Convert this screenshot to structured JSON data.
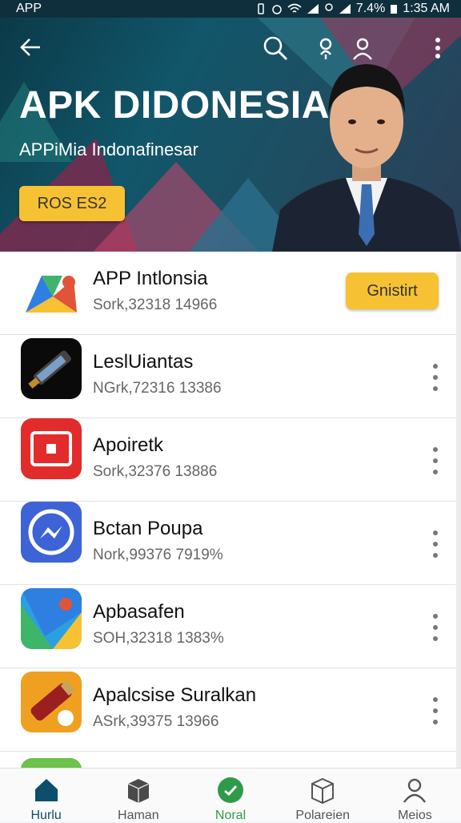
{
  "status_bar": {
    "app_label": "APP",
    "battery": "7.4%",
    "time": "1:35 AM"
  },
  "header": {
    "title": "APK DIDONESIA",
    "subtitle": "APPiMia Indonafinesar",
    "button_label": "ROS ES2"
  },
  "apps": [
    {
      "name": "APP Intlonsia",
      "meta": "Sork,32318 14966",
      "action": "Gnistirt",
      "icon": "maps-pin-icon"
    },
    {
      "name": "LeslUiantas",
      "meta": "NGrk,72316 13386",
      "action": "more",
      "icon": "phone-device-icon"
    },
    {
      "name": "Apoiretk",
      "meta": "Sork,32376 13886",
      "action": "more",
      "icon": "record-icon"
    },
    {
      "name": "Bctan Poupa",
      "meta": "Nork,99376 7919%",
      "action": "more",
      "icon": "messenger-icon"
    },
    {
      "name": "Apbasafen",
      "meta": "SOH,32318 1383%",
      "action": "more",
      "icon": "maps-icon"
    },
    {
      "name": "Apalcsise Suralkan",
      "meta": "ASrk,39375 13966",
      "action": "more",
      "icon": "tool-icon"
    }
  ],
  "bottom_nav": [
    {
      "label": "Hurlu",
      "icon": "home-icon"
    },
    {
      "label": "Haman",
      "icon": "box-icon"
    },
    {
      "label": "Noral",
      "icon": "badge-icon"
    },
    {
      "label": "Polareien",
      "icon": "cube-icon"
    },
    {
      "label": "Meios",
      "icon": "person-icon"
    }
  ],
  "colors": {
    "accent": "#f6c233",
    "header_bg": "#11566a",
    "nav_active": "#0b4f6c"
  }
}
